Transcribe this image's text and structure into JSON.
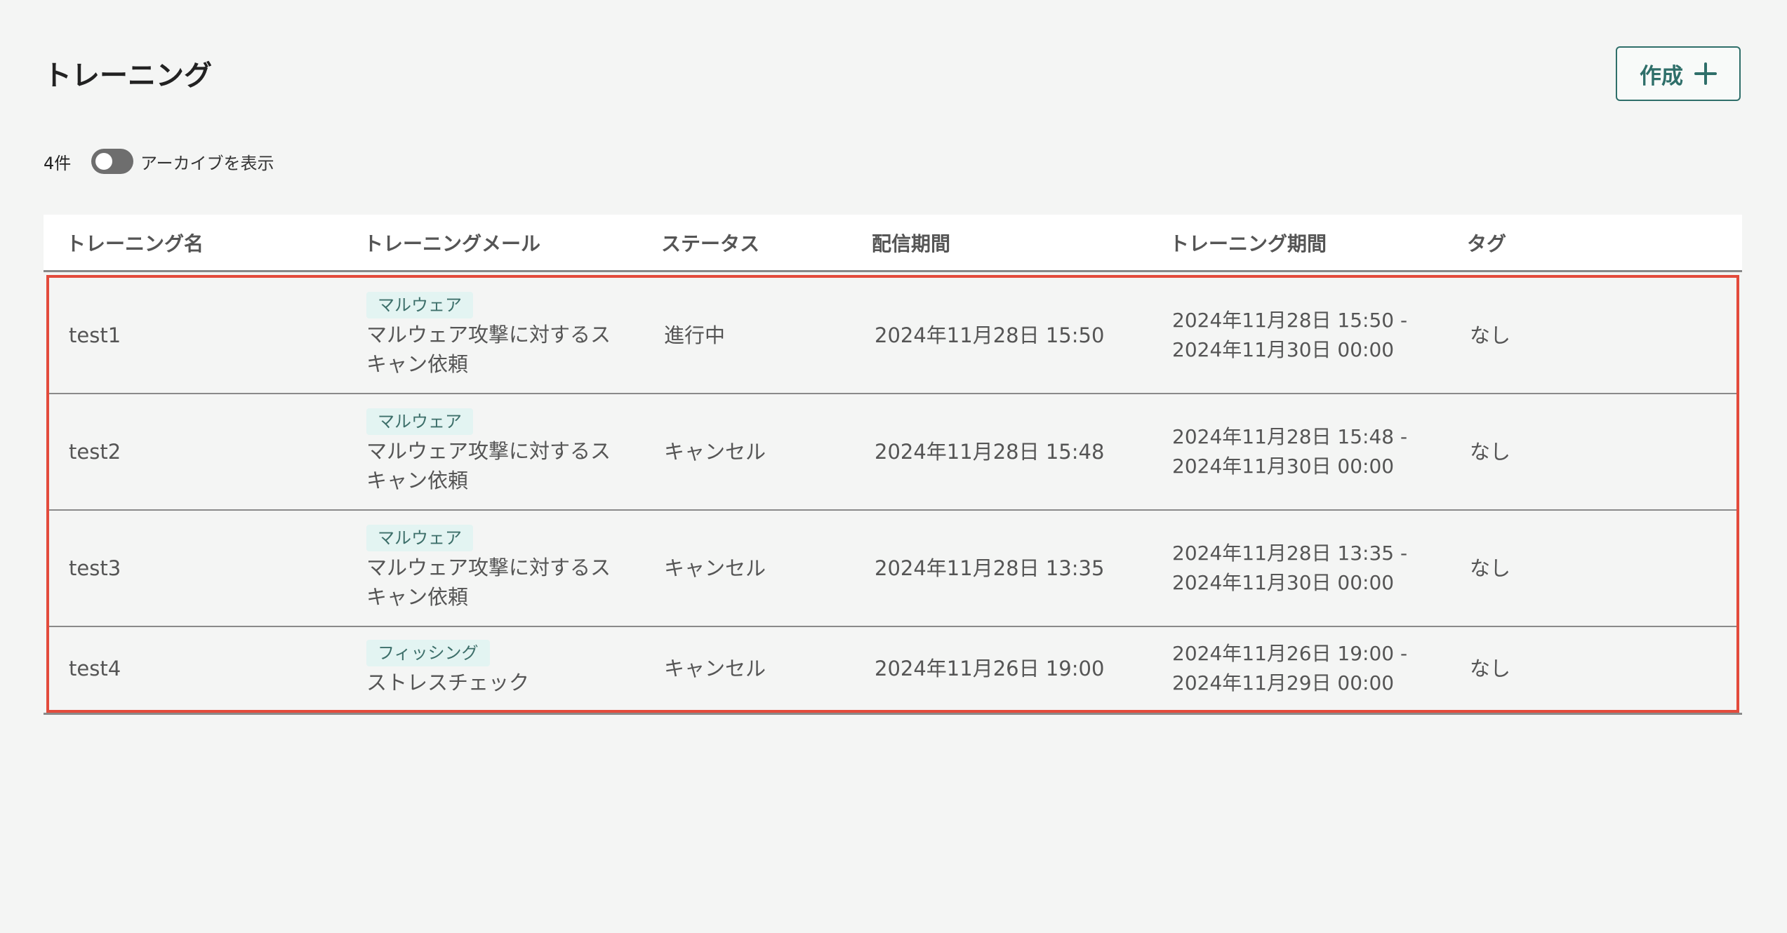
{
  "page": {
    "title": "トレーニング",
    "create_label": "作成"
  },
  "filter": {
    "count": "4件",
    "archive_label": "アーカイブを表示",
    "archive_enabled": false
  },
  "table": {
    "headers": [
      "トレーニング名",
      "トレーニングメール",
      "ステータス",
      "配信期間",
      "トレーニング期間",
      "タグ"
    ],
    "rows": [
      {
        "name": "test1",
        "mail_tag": "マルウェア",
        "mail_name": "マルウェア攻撃に対するスキャン依頼",
        "status": "進行中",
        "delivery": "2024年11月28日 15:50",
        "period_start": "2024年11月28日 15:50 -",
        "period_end": "2024年11月30日 00:00",
        "tag": "なし"
      },
      {
        "name": "test2",
        "mail_tag": "マルウェア",
        "mail_name": "マルウェア攻撃に対するスキャン依頼",
        "status": "キャンセル",
        "delivery": "2024年11月28日 15:48",
        "period_start": "2024年11月28日 15:48 -",
        "period_end": "2024年11月30日 00:00",
        "tag": "なし"
      },
      {
        "name": "test3",
        "mail_tag": "マルウェア",
        "mail_name": "マルウェア攻撃に対するスキャン依頼",
        "status": "キャンセル",
        "delivery": "2024年11月28日 13:35",
        "period_start": "2024年11月28日 13:35 -",
        "period_end": "2024年11月30日 00:00",
        "tag": "なし"
      },
      {
        "name": "test4",
        "mail_tag": "フィッシング",
        "mail_name": "ストレスチェック",
        "status": "キャンセル",
        "delivery": "2024年11月26日 19:00",
        "period_start": "2024年11月26日 19:00 -",
        "period_end": "2024年11月29日 00:00",
        "tag": "なし"
      }
    ]
  },
  "colors": {
    "accent": "#2f6f6a",
    "highlight_border": "#e34b3c",
    "tag_bg": "#e3f4f2",
    "background": "#f4f5f4"
  }
}
